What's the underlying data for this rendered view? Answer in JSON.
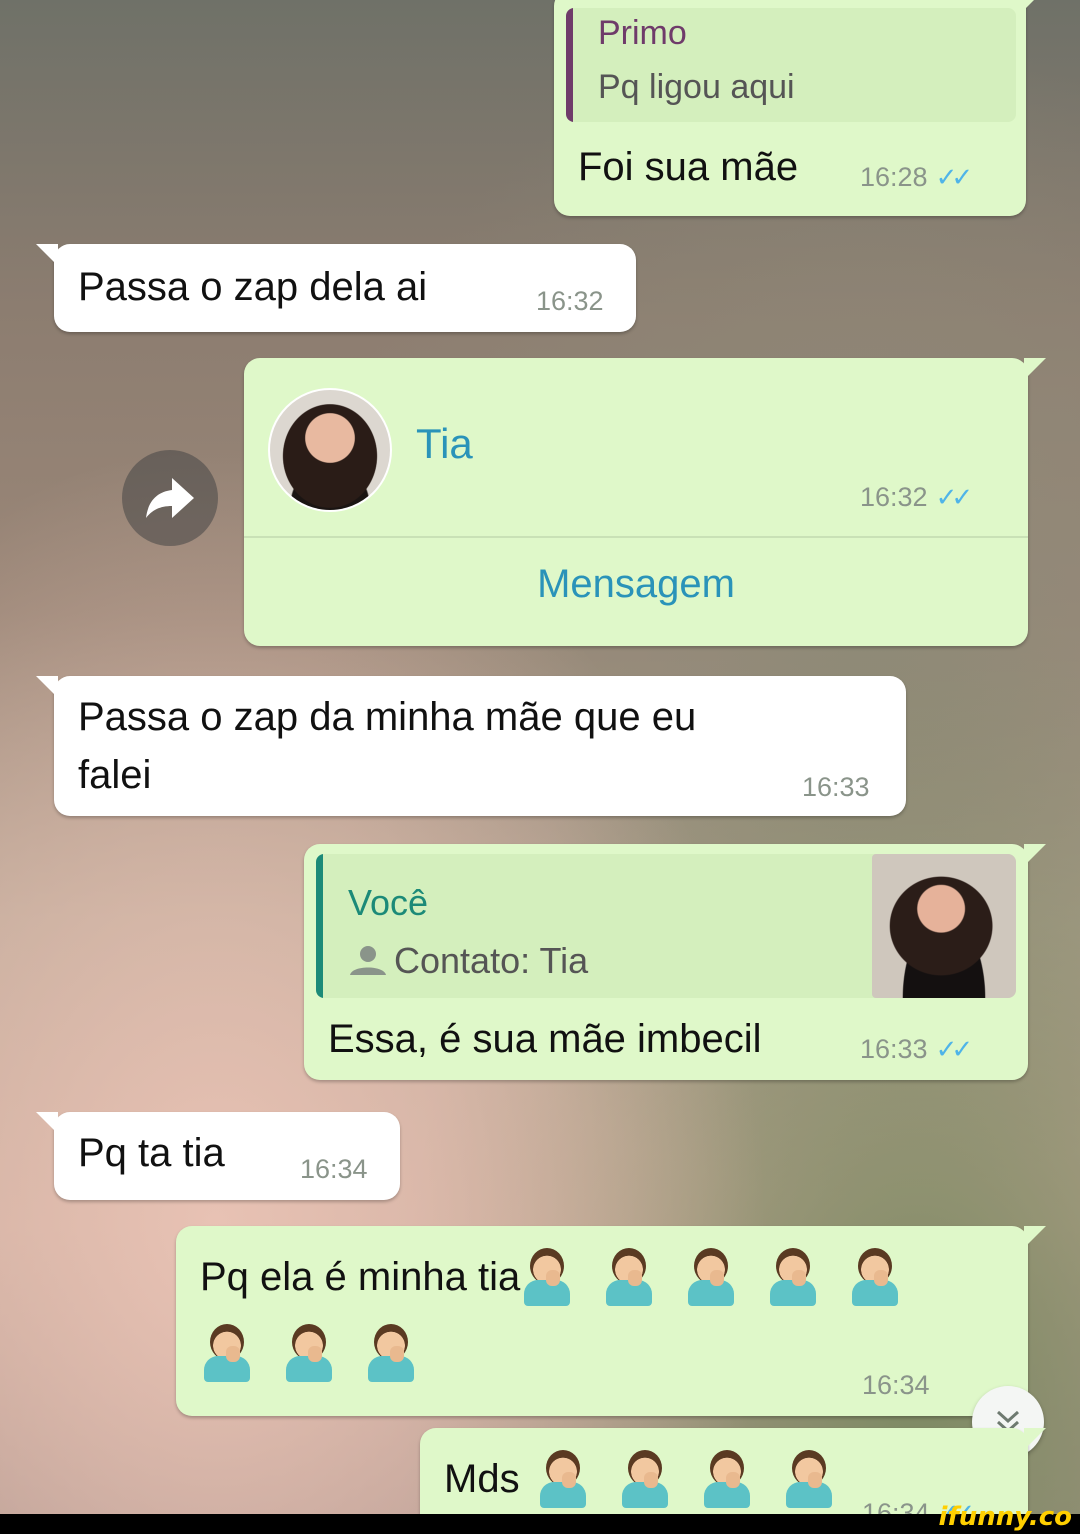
{
  "messages": [
    {
      "id": "m1",
      "type": "reply",
      "quote": {
        "author": "Primo",
        "text": "Pq ligou aqui"
      },
      "text": "Foi sua mãe",
      "time": "16:28",
      "ticks": "✓✓"
    },
    {
      "id": "m2",
      "type": "incoming",
      "text": "Passa o zap dela ai",
      "time": "16:32"
    },
    {
      "id": "m3",
      "type": "contact",
      "contact_name": "Tia",
      "time": "16:32",
      "ticks": "✓✓",
      "action_label": "Mensagem"
    },
    {
      "id": "m4",
      "type": "incoming",
      "text_line1": "Passa o zap da minha mãe que eu",
      "text_line2": "falei",
      "time": "16:33"
    },
    {
      "id": "m5",
      "type": "reply",
      "quote": {
        "author": "Você",
        "text": "Contato: Tia"
      },
      "text": "Essa, é sua mãe imbecil",
      "time": "16:33",
      "ticks": "✓✓"
    },
    {
      "id": "m6",
      "type": "incoming",
      "text": "Pq ta tia",
      "time": "16:34"
    },
    {
      "id": "m7",
      "type": "outgoing",
      "text": "Pq ela é minha tia",
      "emoji_line1_count": 5,
      "emoji_line2_count": 3,
      "time": "16:34"
    },
    {
      "id": "m8",
      "type": "outgoing",
      "text": "Mds",
      "emoji_count": 4,
      "time": "16:34",
      "ticks": "✓✓"
    }
  ],
  "icons": {
    "forward": "forward-arrow-icon",
    "scroll_down": "double-chevron-down-icon",
    "contact": "person-icon"
  },
  "colors": {
    "outgoing_bubble": "#dff8c9",
    "incoming_bubble": "#ffffff",
    "quote_primo_bar": "#6f3b6a",
    "quote_voce_bar": "#1c8a78",
    "contact_name": "#2a93b9",
    "read_ticks": "#4fb4e8"
  },
  "watermark": "ifunny.co"
}
